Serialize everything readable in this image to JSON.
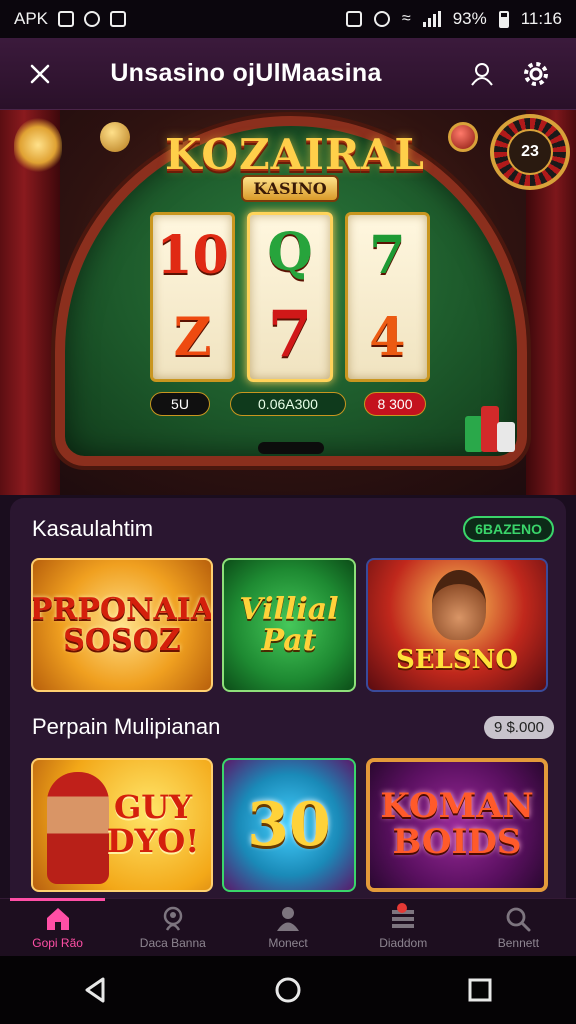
{
  "status_bar": {
    "carrier": "APK",
    "battery": "93%",
    "time": "11:16"
  },
  "app_bar": {
    "title": "Unsasino ojUlMaasina",
    "close_icon": "close-icon",
    "profile_icon": "user-icon",
    "settings_icon": "gear-icon"
  },
  "hero": {
    "logo_title": "KOZAIRAL",
    "logo_subtitle": "KASINO",
    "dial_label": "23",
    "reels": [
      [
        "10",
        "Z"
      ],
      [
        "Q",
        "7"
      ],
      [
        "7",
        "4"
      ]
    ],
    "bet_label": "5U",
    "balance_label": "0.06A300",
    "win_label": "8 300"
  },
  "section1": {
    "title": "Kasaulahtim",
    "badge": "6BAZENO",
    "cards": [
      {
        "text": "PRPONAIA SOSOZ"
      },
      {
        "text": "Villial Pat"
      },
      {
        "text": "SELSNO"
      }
    ]
  },
  "section2": {
    "title": "Perpain Mulipianan",
    "badge": "9 $.000",
    "cards": [
      {
        "text": "GUY DYO!"
      },
      {
        "text": "30"
      },
      {
        "text": "KOMAN BOIDS"
      }
    ]
  },
  "bottom_nav": [
    {
      "label": "Gopi Rão",
      "icon": "home-icon",
      "active": true
    },
    {
      "label": "Daca Banna",
      "icon": "search-person-icon",
      "active": false
    },
    {
      "label": "Monect",
      "icon": "person-icon",
      "active": false
    },
    {
      "label": "Diaddom",
      "icon": "list-icon",
      "active": false
    },
    {
      "label": "Bennett",
      "icon": "search-icon",
      "active": false
    }
  ],
  "system_nav": {
    "back_icon": "back-icon",
    "home_icon": "home-circle-icon",
    "recents_icon": "recents-icon"
  },
  "colors": {
    "accent": "#ff4fa6",
    "panel": "#2a1630",
    "badge_green": "#3ad56a"
  }
}
